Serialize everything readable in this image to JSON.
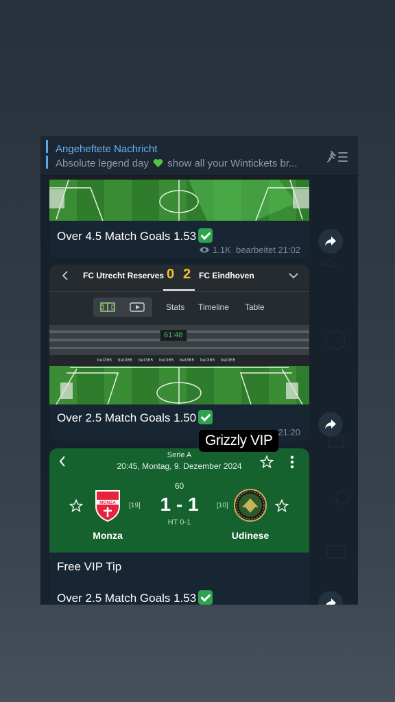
{
  "pinned": {
    "title": "Angeheftete Nachricht",
    "text_before": "Absolute legend day",
    "text_after": "show all your Wintickets br..."
  },
  "messages": [
    {
      "caption": "Over 4.5 Match Goals 1.53",
      "views": "1.1K",
      "meta": "bearbeitet 21:02"
    },
    {
      "home": "FC Utrecht Reserves",
      "home_score": "0",
      "away_score": "2",
      "away": "FC Eindhoven",
      "tabs": [
        "Stats",
        "Timeline",
        "Table"
      ],
      "clock": "61:48",
      "ad_text": "bet365",
      "caption": "Over 2.5 Match Goals 1.50",
      "time": "21:20"
    },
    {
      "league": "Serie A",
      "datetime": "20:45, Montag, 9. Dezember 2024",
      "minute": "60",
      "score": "1 - 1",
      "ht": "HT 0-1",
      "home": "Monza",
      "home_rank": "[19]",
      "away": "Udinese",
      "away_rank": "[10]",
      "home_crest_text": "MONZA",
      "caption_title": "Free VIP Tip",
      "caption": "Over 2.5 Match Goals 1.53"
    }
  ],
  "badge": "Grizzly VIP",
  "colors": {
    "accent": "#6ab2f2",
    "bubble": "#182533",
    "chat_bg": "#17212b",
    "card_green": "#15622f",
    "score_yellow": "#f2c230",
    "check_green": "#2ea44f"
  }
}
